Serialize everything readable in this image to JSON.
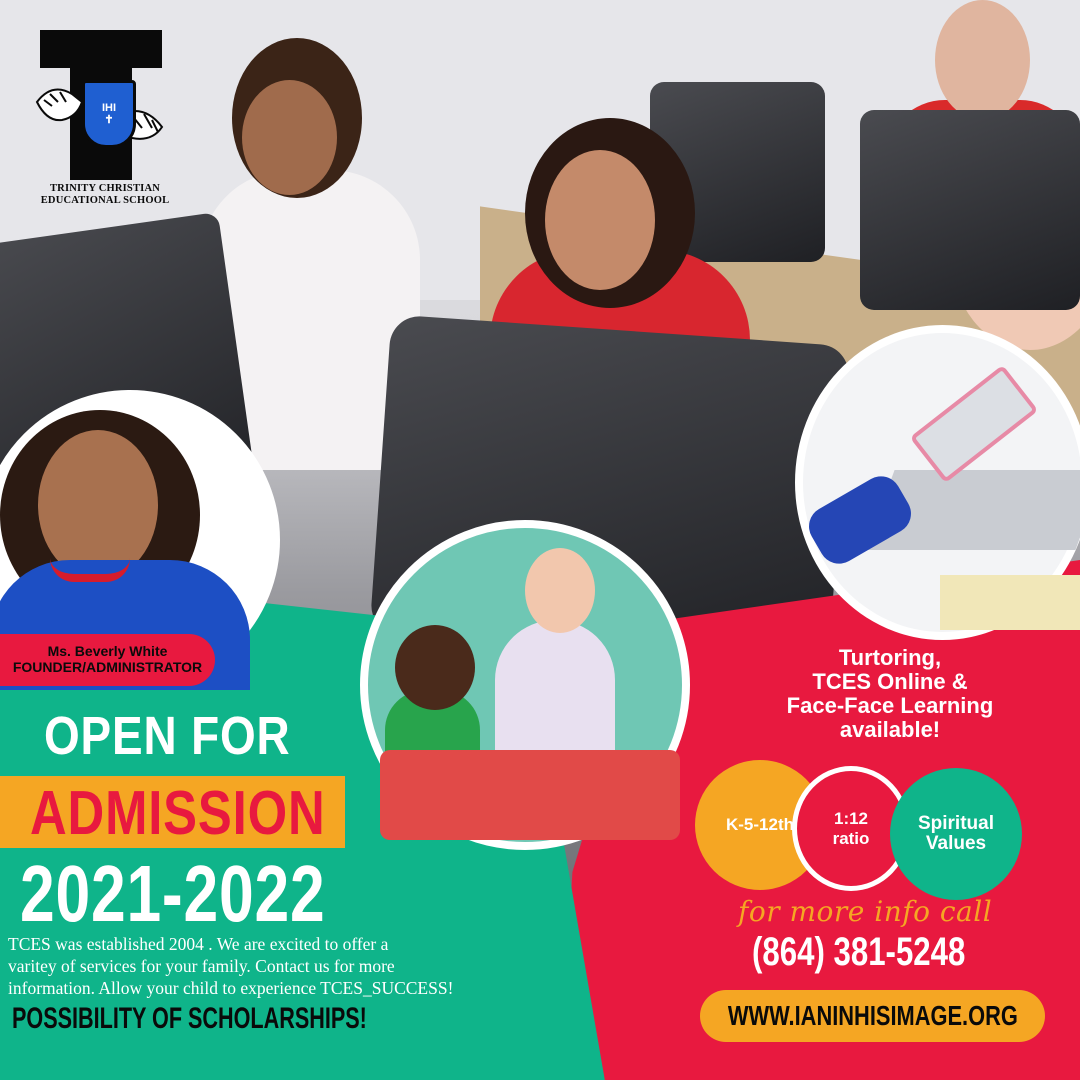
{
  "logo": {
    "shield_monogram": "IHI",
    "school_line1": "TRINITY CHRISTIAN",
    "school_line2": "EDUCATIONAL SCHOOL"
  },
  "founder": {
    "name": "Ms. Beverly White",
    "title": "FOUNDER/ADMINISTRATOR"
  },
  "headline": {
    "line1": "OPEN FOR",
    "line2": "ADMISSION",
    "line3": "2021-2022"
  },
  "description": {
    "line1": "TCES  was established 2004 .  We are excited to offer a",
    "line2": " varitey of services for your family.  Contact us for more",
    "line3": "information.  Allow your child to experience TCES_SUCCESS!"
  },
  "scholarship": "POSSIBILITY OF SCHOLARSHIPS!",
  "services": {
    "line1": "Turtoring,",
    "line2": "TCES Online &",
    "line3": "Face-Face Learning",
    "line4": "available!"
  },
  "bubbles": {
    "grades": "K-5-12th",
    "ratio_value": "1:12",
    "ratio_label": "ratio",
    "values_line1": "Spiritual",
    "values_line2": "Values"
  },
  "contact": {
    "more_info": "for more info  call",
    "phone": "(864) 381-5248",
    "website": "WWW.IANINHISIMAGE.ORG"
  },
  "colors": {
    "green": "#0fb48a",
    "red": "#e8193f",
    "orange": "#f5a623",
    "blue": "#1f5fd1"
  }
}
